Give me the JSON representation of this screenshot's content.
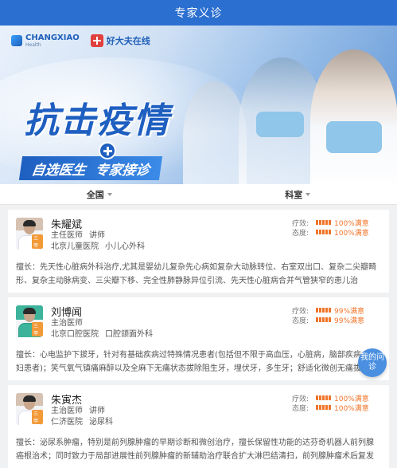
{
  "header": {
    "title": "专家义诊"
  },
  "banner": {
    "logo_changxiao": "CHANGXIAO",
    "logo_changxiao_sub": "Health",
    "logo_haodaifu": "好大夫在线",
    "headline": "抗击疫情",
    "tagline_1": "自选医生",
    "tagline_2": "专家接诊"
  },
  "filters": [
    {
      "label": "全国"
    },
    {
      "label": "科室"
    }
  ],
  "doctors": [
    {
      "name": "朱耀斌",
      "title": "主任医师",
      "academic": "讲师",
      "hospital": "北京儿童医院",
      "department": "小儿心外科",
      "badge": "三甲",
      "effect_label": "疗效:",
      "effect_value": "100%满意",
      "attitude_label": "态度:",
      "attitude_value": "100%满意",
      "description": "擅长：先天性心脏病外科治疗,尤其是婴幼儿复杂先心病如复杂大动脉转位、右室双出口、复杂二尖瓣畸形、复杂主动脉病变、三尖瓣下移、完全性肺静脉异位引流、先天性心脏病合并气管狭窄的患儿治疗、..."
    },
    {
      "name": "刘博闻",
      "title": "主治医师",
      "academic": "",
      "hospital": "北京口腔医院",
      "department": "口腔颌面外科",
      "badge": "三甲",
      "effect_label": "疗效:",
      "effect_value": "99%满意",
      "attitude_label": "态度:",
      "attitude_value": "99%满意",
      "description": "擅长：心电监护下拔牙，针对有基础疾病过特殊情况患者(包括但不限于高血压，心脏病，脑部疾病，孕妇患者)；笑气氧气镇痛麻醉以及全麻下无痛状态拔除阻生牙，埋伏牙，多生牙；舒适化微创无痛拔除儿童..."
    },
    {
      "name": "朱寅杰",
      "title": "主治医师",
      "academic": "讲师",
      "hospital": "仁济医院",
      "department": "泌尿科",
      "badge": "三甲",
      "effect_label": "疗效:",
      "effect_value": "100%满意",
      "attitude_label": "态度:",
      "attitude_value": "100%满意",
      "description": "擅长：泌尿系肿瘤，特别是前列腺肿瘤的早期诊断和微创治疗，擅长保留性功能的达芬奇机器人前列腺癌根治术；同时致力于局部进展性前列腺肿瘤的新辅助治疗联合扩大淋巴结清扫，前列腺肿瘤术后复发綜..."
    }
  ],
  "float_button": {
    "label": "我的问诊"
  },
  "colors": {
    "primary": "#2b6fd0",
    "accent": "#f0752b",
    "badge": "#f29a38"
  }
}
